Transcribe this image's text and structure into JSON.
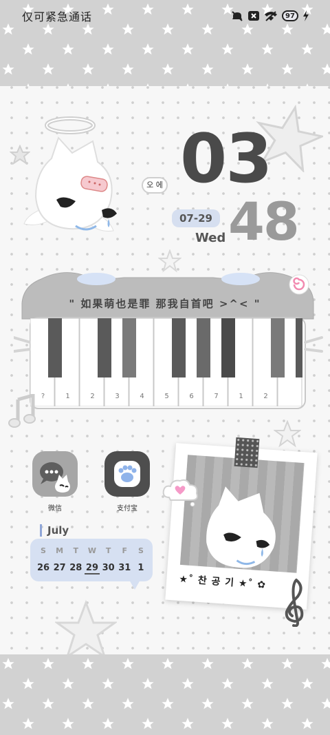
{
  "status_bar": {
    "carrier_text": "仅可紧急通话",
    "battery_level": "97",
    "icons": [
      "mute-icon",
      "no-sim-icon",
      "wifi-icon",
      "battery-icon",
      "charging-icon"
    ]
  },
  "clock": {
    "hour": "03",
    "minute": "48",
    "date": "07-29",
    "weekday": "Wed"
  },
  "mascot_speech": "오 에",
  "piano": {
    "lyric": "\" 如果萌也是罪  那我自首吧  >^< \"",
    "key_labels": [
      "?",
      "1",
      "2",
      "3",
      "4",
      "5",
      "6",
      "7",
      "1",
      "2",
      ""
    ]
  },
  "apps": [
    {
      "label": "微信",
      "icon": "wechat-icon"
    },
    {
      "label": "支付宝",
      "icon": "alipay-paw-icon"
    }
  ],
  "calendar": {
    "month": "July",
    "weekdays": [
      "S",
      "M",
      "T",
      "W",
      "T",
      "F",
      "S"
    ],
    "dates": [
      "26",
      "27",
      "28",
      "29",
      "30",
      "31",
      "1"
    ],
    "today": "29"
  },
  "polaroid": {
    "caption": "★˚ 찬 공 기 ★˚ ✿"
  },
  "colors": {
    "band": "#d2d2d2",
    "accent_blue": "#d6e0f2",
    "hour_text": "#4a4a4a",
    "minute_text": "#9a9a9a"
  }
}
